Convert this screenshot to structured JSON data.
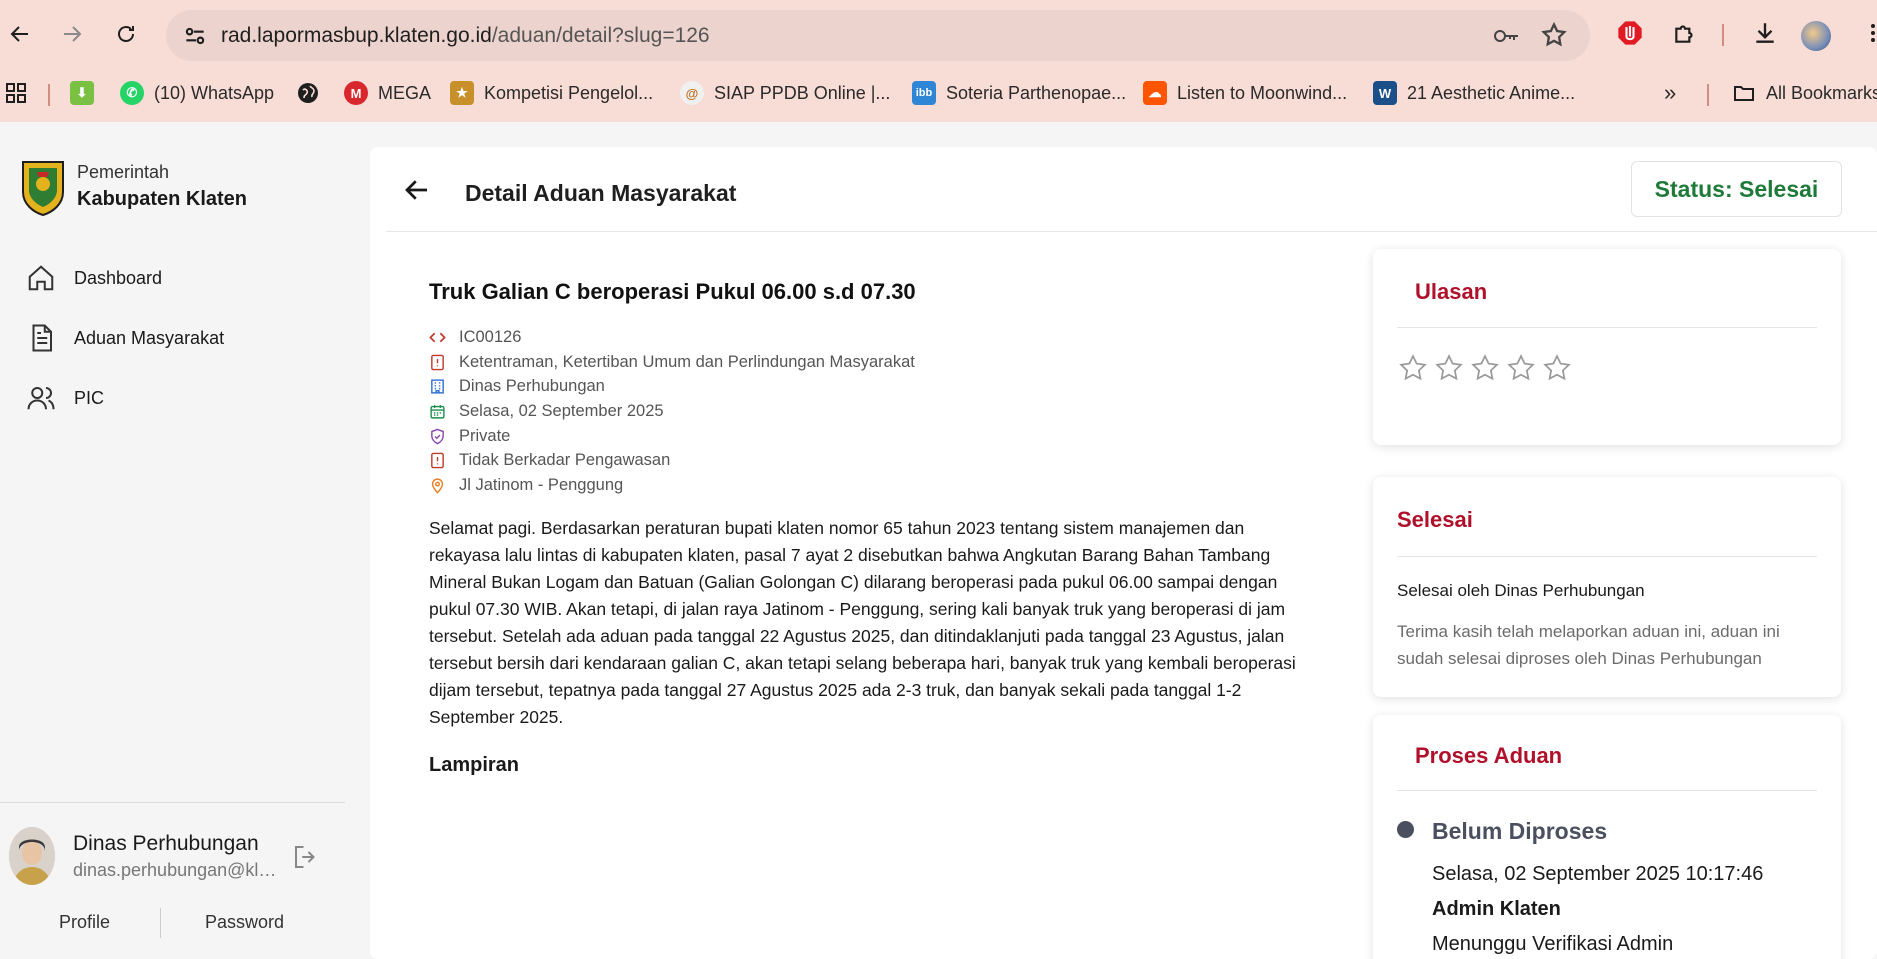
{
  "browser": {
    "url_host": "rad.lapormasbup.klaten.go.id",
    "url_path": "/aduan/detail?slug=126",
    "bookmarks": [
      {
        "label": "(10) WhatsApp",
        "icon": "whatsapp-icon"
      },
      {
        "label": "",
        "icon": "globe-icon"
      },
      {
        "label": "MEGA",
        "icon": "mega-icon"
      },
      {
        "label": "Kompetisi Pengelol...",
        "icon": "kompetisi-icon"
      },
      {
        "label": "SIAP PPDB Online |...",
        "icon": "siap-icon"
      },
      {
        "label": "Soteria Parthenopae...",
        "icon": "ibb-icon"
      },
      {
        "label": "Listen to Moonwind...",
        "icon": "soundcloud-icon"
      },
      {
        "label": "21 Aesthetic Anime...",
        "icon": "w-icon"
      }
    ],
    "all_bookmarks": "All Bookmarks",
    "overflow": "»"
  },
  "sidebar": {
    "brand_top": "Pemerintah",
    "brand_bottom": "Kabupaten Klaten",
    "menu": [
      {
        "label": "Dashboard",
        "icon": "home-icon"
      },
      {
        "label": "Aduan Masyarakat",
        "icon": "document-icon"
      },
      {
        "label": "PIC",
        "icon": "users-icon"
      }
    ],
    "user": {
      "name": "Dinas Perhubungan",
      "email": "dinas.perhubungan@klaten.go.id"
    },
    "links": {
      "profile": "Profile",
      "password": "Password"
    }
  },
  "header": {
    "title": "Detail Aduan Masyarakat",
    "status": "Status: Selesai"
  },
  "complaint": {
    "title": "Truk Galian C beroperasi Pukul 06.00 s.d 07.30",
    "meta": [
      {
        "icon": "code-icon",
        "text": "IC00126",
        "color": "#c0392b"
      },
      {
        "icon": "alert-icon",
        "text": "Ketentraman, Ketertiban Umum dan Perlindungan Masyarakat",
        "color": "#c0392b"
      },
      {
        "icon": "building-icon",
        "text": "Dinas Perhubungan",
        "color": "#2f6fd6"
      },
      {
        "icon": "calendar-icon",
        "text": "Selasa, 02 September 2025",
        "color": "#1e8f4e"
      },
      {
        "icon": "shield-icon",
        "text": "Private",
        "color": "#8e44ad"
      },
      {
        "icon": "alert-icon",
        "text": "Tidak Berkadar Pengawasan",
        "color": "#c0392b"
      },
      {
        "icon": "pin-icon",
        "text": "Jl Jatinom - Penggung",
        "color": "#e67e22"
      }
    ],
    "description": "Selamat pagi. Berdasarkan peraturan bupati klaten nomor 65 tahun 2023 tentang sistem manajemen dan rekayasa lalu lintas di kabupaten klaten, pasal 7 ayat 2 disebutkan bahwa Angkutan Barang Bahan Tambang Mineral Bukan Logam dan Batuan (Galian Golongan C) dilarang beroperasi pada pukul 06.00 sampai dengan pukul 07.30 WIB. Akan tetapi, di jalan raya Jatinom - Penggung, sering kali banyak truk yang beroperasi di jam tersebut. Setelah ada aduan pada tanggal 22 Agustus 2025, dan ditindaklanjuti pada tanggal 23 Agustus, jalan tersebut bersih dari kendaraan galian C, akan tetapi selang beberapa hari, banyak truk yang kembali beroperasi dijam tersebut, tepatnya pada tanggal 27 Agustus 2025 ada 2-3 truk, dan banyak sekali pada tanggal 1-2 September 2025.",
    "attachments_label": "Lampiran"
  },
  "review": {
    "title": "Ulasan",
    "rating": 0,
    "max_rating": 5
  },
  "completion": {
    "title": "Selesai",
    "by": "Selesai oleh Dinas Perhubungan",
    "message": "Terima kasih telah melaporkan aduan ini, aduan ini sudah selesai diproses oleh Dinas Perhubungan"
  },
  "process": {
    "title": "Proses Aduan",
    "steps": [
      {
        "status": "Belum Diproses",
        "datetime": "Selasa, 02 September 2025 10:17:46",
        "actor": "Admin Klaten",
        "note": "Menunggu Verifikasi Admin"
      }
    ]
  },
  "colors": {
    "accent_red": "#b0102a",
    "status_green": "#1f7a3a",
    "chrome_bg": "#f8dcd6"
  }
}
